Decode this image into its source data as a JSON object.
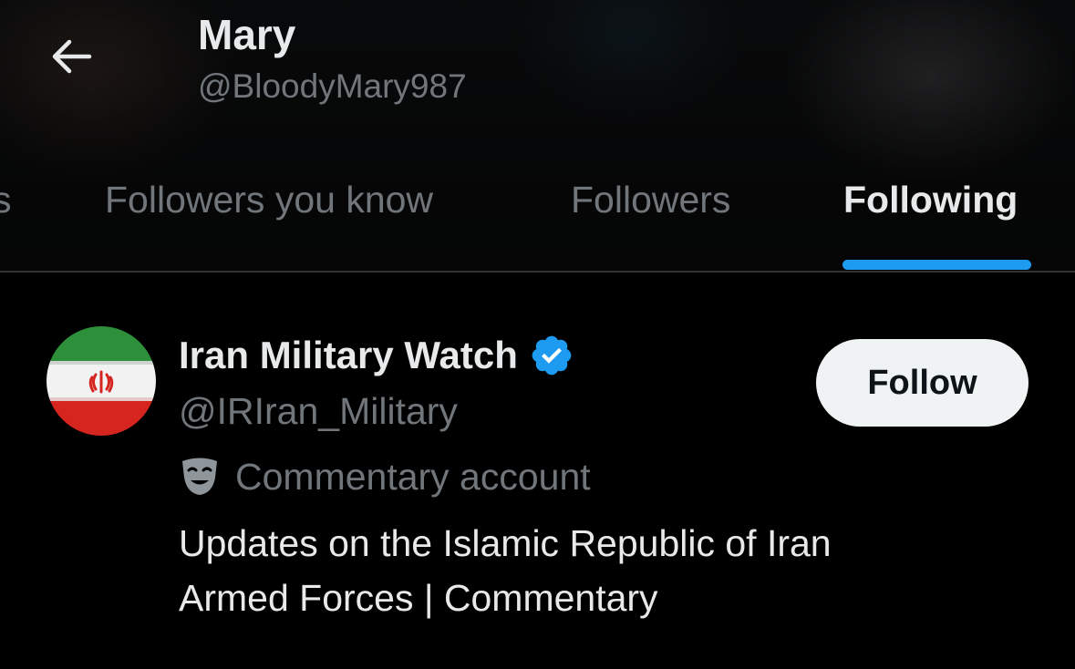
{
  "header": {
    "name": "Mary",
    "handle": "@BloodyMary987"
  },
  "tabs": [
    {
      "label": "s",
      "active": false
    },
    {
      "label": "Followers you know",
      "active": false
    },
    {
      "label": "Followers",
      "active": false
    },
    {
      "label": "Following",
      "active": true
    }
  ],
  "user": {
    "name": "Iran Military Watch",
    "handle": "@IRIran_Military",
    "verified": true,
    "label": "Commentary account",
    "bio_lines": [
      "Updates on the Islamic Republic of Iran",
      "Armed Forces | Commentary"
    ],
    "follow_label": "Follow"
  },
  "colors": {
    "background": "#000000",
    "text_primary": "#e7e9ea",
    "text_secondary": "#71767b",
    "accent": "#1d9bf0",
    "button_bg": "#eff3f4",
    "button_text": "#0f1419"
  },
  "icons": {
    "back": "arrow-left-icon",
    "verified": "verified-badge-icon",
    "label": "theater-mask-icon"
  }
}
